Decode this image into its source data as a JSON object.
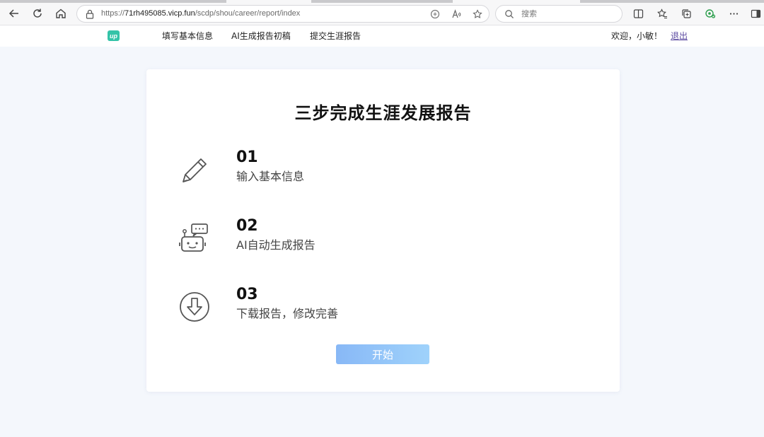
{
  "browser": {
    "url_prefix": "https://",
    "url_host": "71rh495085.vicp.fun",
    "url_path": "/scdp/shou/career/report/index",
    "search_placeholder": "搜索",
    "icons": [
      "back-icon",
      "refresh-icon",
      "home-icon",
      "lock-icon",
      "reader-icon",
      "read-aloud-icon",
      "favorite-star-icon",
      "search-icon",
      "split-screen-icon",
      "favorites-icon",
      "collections-icon",
      "extension-icon",
      "more-icon",
      "sidebar-icon"
    ]
  },
  "header": {
    "logo_text": "up",
    "nav": [
      {
        "label": "填写基本信息"
      },
      {
        "label": "AI生成报告初稿"
      },
      {
        "label": "提交生涯报告"
      }
    ],
    "welcome": "欢迎，小敏！",
    "logout": "退出"
  },
  "main": {
    "title": "三步完成生涯发展报告",
    "steps": [
      {
        "num": "01",
        "desc": "输入基本信息",
        "icon": "pencil-icon"
      },
      {
        "num": "02",
        "desc": "AI自动生成报告",
        "icon": "robot-chat-icon"
      },
      {
        "num": "03",
        "desc": "下载报告，修改完善",
        "icon": "download-circle-icon"
      }
    ],
    "start_button": "开始"
  },
  "colors": {
    "accent_gradient_start": "#88b8f6",
    "accent_gradient_end": "#9fd2fb",
    "logo_green": "#34c3a8",
    "logout_link": "#5b4aa0",
    "page_background": "#f4f7fc"
  }
}
